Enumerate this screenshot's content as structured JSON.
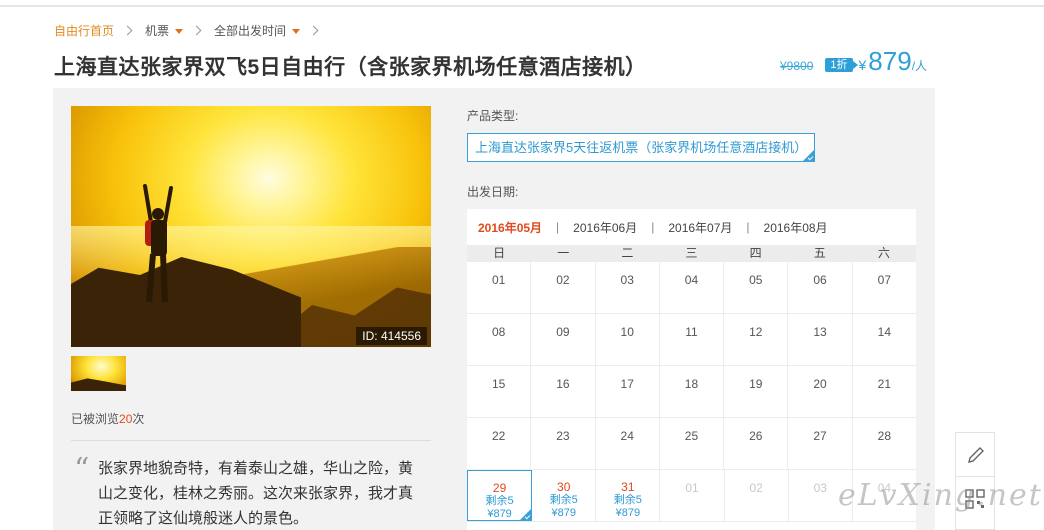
{
  "breadcrumb": {
    "home": "自由行首页",
    "category": "机票",
    "departure": "全部出发时间"
  },
  "title": "上海直达张家界双飞5日自由行（含张家界机场任意酒店接机）",
  "price": {
    "original": "¥9800",
    "discount": "1折",
    "yen": "¥",
    "current": "879",
    "unit": "/人"
  },
  "gallery": {
    "photo_id": "ID: 414556"
  },
  "views": {
    "prefix": "已被浏览",
    "count": "20",
    "suffix": "次"
  },
  "quote": "张家界地貌奇特，有着泰山之雄，华山之险，黄山之变化，桂林之秀丽。这次来张家界，我才真正领略了这仙境般迷人的景色。",
  "product": {
    "label": "产品类型:",
    "selected": "上海直达张家界5天往返机票（张家界机场任意酒店接机）"
  },
  "calendar": {
    "label": "出发日期:",
    "months": [
      "2016年05月",
      "2016年06月",
      "2016年07月",
      "2016年08月"
    ],
    "active_month": 0,
    "weekdays": [
      "日",
      "一",
      "二",
      "三",
      "四",
      "五",
      "六"
    ],
    "rows": [
      [
        {
          "d": "01"
        },
        {
          "d": "02"
        },
        {
          "d": "03"
        },
        {
          "d": "04"
        },
        {
          "d": "05"
        },
        {
          "d": "06"
        },
        {
          "d": "07"
        }
      ],
      [
        {
          "d": "08"
        },
        {
          "d": "09"
        },
        {
          "d": "10"
        },
        {
          "d": "11"
        },
        {
          "d": "12"
        },
        {
          "d": "13"
        },
        {
          "d": "14"
        }
      ],
      [
        {
          "d": "15"
        },
        {
          "d": "16"
        },
        {
          "d": "17"
        },
        {
          "d": "18"
        },
        {
          "d": "19"
        },
        {
          "d": "20"
        },
        {
          "d": "21"
        }
      ],
      [
        {
          "d": "22"
        },
        {
          "d": "23"
        },
        {
          "d": "24"
        },
        {
          "d": "25"
        },
        {
          "d": "26"
        },
        {
          "d": "27"
        },
        {
          "d": "28"
        }
      ],
      [
        {
          "d": "29",
          "stock": "剩余5",
          "price": "¥879",
          "selected": true
        },
        {
          "d": "30",
          "stock": "剩余5",
          "price": "¥879"
        },
        {
          "d": "31",
          "stock": "剩余5",
          "price": "¥879"
        },
        {
          "d": "01",
          "dim": true
        },
        {
          "d": "02",
          "dim": true
        },
        {
          "d": "03",
          "dim": true
        },
        {
          "d": "04",
          "dim": true
        }
      ]
    ]
  },
  "side_tools": {
    "icons": [
      "pencil-icon",
      "qr-code-icon"
    ]
  },
  "watermark": "eLvXing.net",
  "colors": {
    "accent_blue": "#2ea0d8",
    "accent_orange": "#e08a1e",
    "highlight_red": "#e04a1e"
  }
}
